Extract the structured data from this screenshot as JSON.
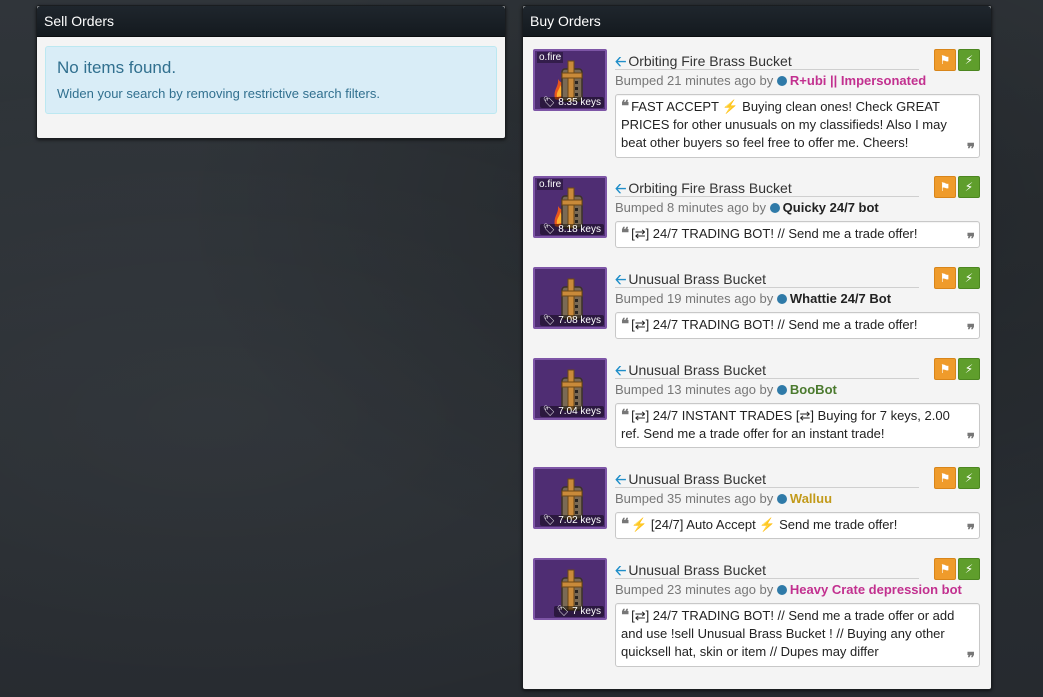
{
  "sell_orders": {
    "title": "Sell Orders",
    "empty_heading": "No items found.",
    "empty_hint": "Widen your search by removing restrictive search filters."
  },
  "buy_orders": {
    "title": "Buy Orders",
    "listings": [
      {
        "effect": "o.fire",
        "price": "8.35 keys",
        "item_name": "Orbiting Fire Brass Bucket",
        "bumped": "Bumped 21 minutes ago by",
        "user": "R+ubi",
        "user_suffix": "|| Impersonated",
        "user_color": "#c2308f",
        "message": "FAST ACCEPT ⚡ Buying clean ones! Check GREAT PRICES for other unusuals on my classifieds! Also I may beat other buyers so feel free to offer me. Cheers!"
      },
      {
        "effect": "o.fire",
        "price": "8.18 keys",
        "item_name": "Orbiting Fire Brass Bucket",
        "bumped": "Bumped 8 minutes ago by",
        "user": "Quicky 24/7 bot",
        "user_suffix": "",
        "user_color": "#222222",
        "message": "[⇄] 24/7 TRADING BOT! // Send me a trade offer!"
      },
      {
        "effect": "",
        "price": "7.08 keys",
        "item_name": "Unusual Brass Bucket",
        "bumped": "Bumped 19 minutes ago by",
        "user": "Whattie 24/7 Bot",
        "user_suffix": "",
        "user_color": "#222222",
        "message": "[⇄] 24/7 TRADING BOT! // Send me a trade offer!"
      },
      {
        "effect": "",
        "price": "7.04 keys",
        "item_name": "Unusual Brass Bucket",
        "bumped": "Bumped 13 minutes ago by",
        "user": "BooBot",
        "user_suffix": "",
        "user_color": "#4b7a2e",
        "message": "[⇄] 24/7 INSTANT TRADES [⇄] Buying for 7 keys, 2.00 ref. Send me a trade offer for an instant trade!"
      },
      {
        "effect": "",
        "price": "7.02 keys",
        "item_name": "Unusual Brass Bucket",
        "bumped": "Bumped 35 minutes ago by",
        "user": "Walluu",
        "user_suffix": "",
        "user_color": "#c29a1a",
        "message": "⚡ [24/7] Auto Accept ⚡ Send me trade offer!"
      },
      {
        "effect": "",
        "price": "7 keys",
        "item_name": "Unusual Brass Bucket",
        "bumped": "Bumped 23 minutes ago by",
        "user": "Heavy Crate depression bot",
        "user_suffix": "",
        "user_color": "#c2308f",
        "message": "[⇄] 24/7 TRADING BOT! // Send me a trade offer or add and use !sell Unusual Brass Bucket ! // Buying any other quicksell hat, skin or item // Dupes may differ"
      }
    ]
  },
  "icons": {
    "flag": "flag-icon",
    "bolt": "lightning-icon",
    "tag": "tag-icon",
    "back": "arrow-left-icon",
    "quote": "quote-icon"
  },
  "colors": {
    "quality_unusual": "#7d55a6",
    "flag_button": "#ef9b2b",
    "bolt_button": "#5f9e2c",
    "link_blue": "#1f8ec9"
  }
}
